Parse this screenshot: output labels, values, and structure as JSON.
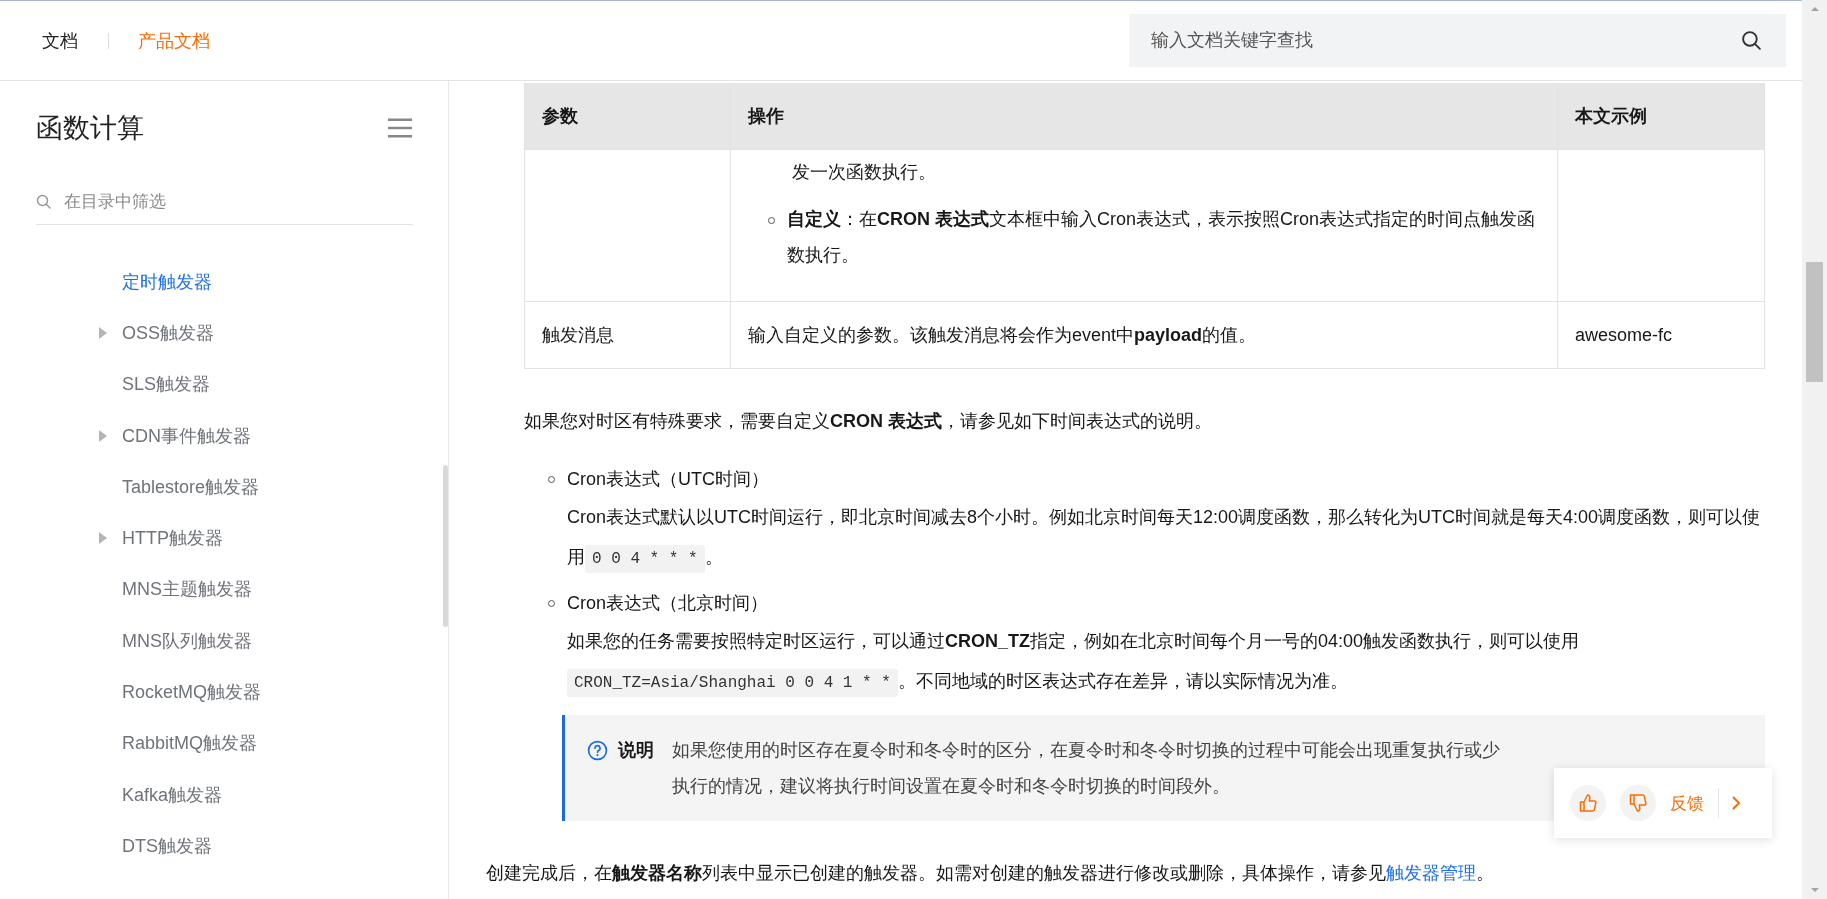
{
  "header": {
    "links": [
      {
        "label": "文档",
        "selected": false
      },
      {
        "label": "产品文档",
        "selected": true
      }
    ],
    "search": {
      "placeholder": "输入文档关键字查找"
    }
  },
  "sidebar": {
    "title": "函数计算",
    "filter": {
      "placeholder": "在目录中筛选"
    },
    "items": [
      {
        "label": "定时触发器",
        "selected": true,
        "expandable": false
      },
      {
        "label": "OSS触发器",
        "selected": false,
        "expandable": true
      },
      {
        "label": "SLS触发器",
        "selected": false,
        "expandable": false
      },
      {
        "label": "CDN事件触发器",
        "selected": false,
        "expandable": true
      },
      {
        "label": "Tablestore触发器",
        "selected": false,
        "expandable": false
      },
      {
        "label": "HTTP触发器",
        "selected": false,
        "expandable": true
      },
      {
        "label": "MNS主题触发器",
        "selected": false,
        "expandable": false
      },
      {
        "label": "MNS队列触发器",
        "selected": false,
        "expandable": false
      },
      {
        "label": "RocketMQ触发器",
        "selected": false,
        "expandable": false
      },
      {
        "label": "RabbitMQ触发器",
        "selected": false,
        "expandable": false
      },
      {
        "label": "Kafka触发器",
        "selected": false,
        "expandable": false
      },
      {
        "label": "DTS触发器",
        "selected": false,
        "expandable": false
      }
    ]
  },
  "table": {
    "columns": [
      "参数",
      "操作",
      "本文示例"
    ],
    "rows": [
      {
        "kind": "partial",
        "operation": [
          {
            "kind": "continuation",
            "text": "发一次函数执行。"
          },
          {
            "kind": "bullet",
            "text": "**自定义**：在**CRON 表达式**文本框中输入Cron表达式，表示按照Cron表达式指定的时间点触发函数执行。"
          }
        ]
      },
      {
        "kind": "full",
        "parameter": "触发消息",
        "operation": [
          {
            "kind": "text",
            "text": "输入自定义的参数。该触发消息将会作为event中**payload**的值。"
          }
        ],
        "example": "awesome-fc"
      }
    ]
  },
  "intro": "如果您对时区有特殊要求，需要自定义**CRON 表达式**，请参见如下时间表达式的说明。",
  "list": [
    {
      "title": "Cron表达式（UTC时间）",
      "body": [
        {
          "kind": "text",
          "text": "Cron表达式默认以UTC时间运行，即北京时间减去8个小时。例如北京时间每天12:00调度函数，那么转化为UTC时间就是每天4:00调度函数，则可以使用"
        },
        {
          "kind": "code",
          "text": "0 0 4 * * *"
        },
        {
          "kind": "text",
          "text": "。"
        }
      ]
    },
    {
      "title": "Cron表达式（北京时间）",
      "body": [
        {
          "kind": "text",
          "text": "如果您的任务需要按照特定时区运行，可以通过**CRON_TZ**指定，例如在北京时间每个月一号的04:00触发函数执行，则可以使用"
        },
        {
          "kind": "code",
          "text": "CRON_TZ=Asia/Shanghai 0 0 4 1 * *"
        },
        {
          "kind": "text",
          "text": "。不同地域的时区表达式存在差异，请以实际情况为准。"
        }
      ]
    }
  ],
  "note": {
    "label": "说明",
    "text": "如果您使用的时区存在夏令时和冬令时的区分，在夏令时和冬令时切换的过程中可能会出现重复执行或少执行的情况，建议将执行时间设置在夏令时和冬令时切换的时间段外。"
  },
  "closing": {
    "text": "创建完成后，在**触发器名称**列表中显示已创建的触发器。如需对创建的触发器进行修改或删除，具体操作，请参见",
    "link": "触发器管理",
    "end": "。"
  },
  "feedback": {
    "label": "反馈"
  }
}
